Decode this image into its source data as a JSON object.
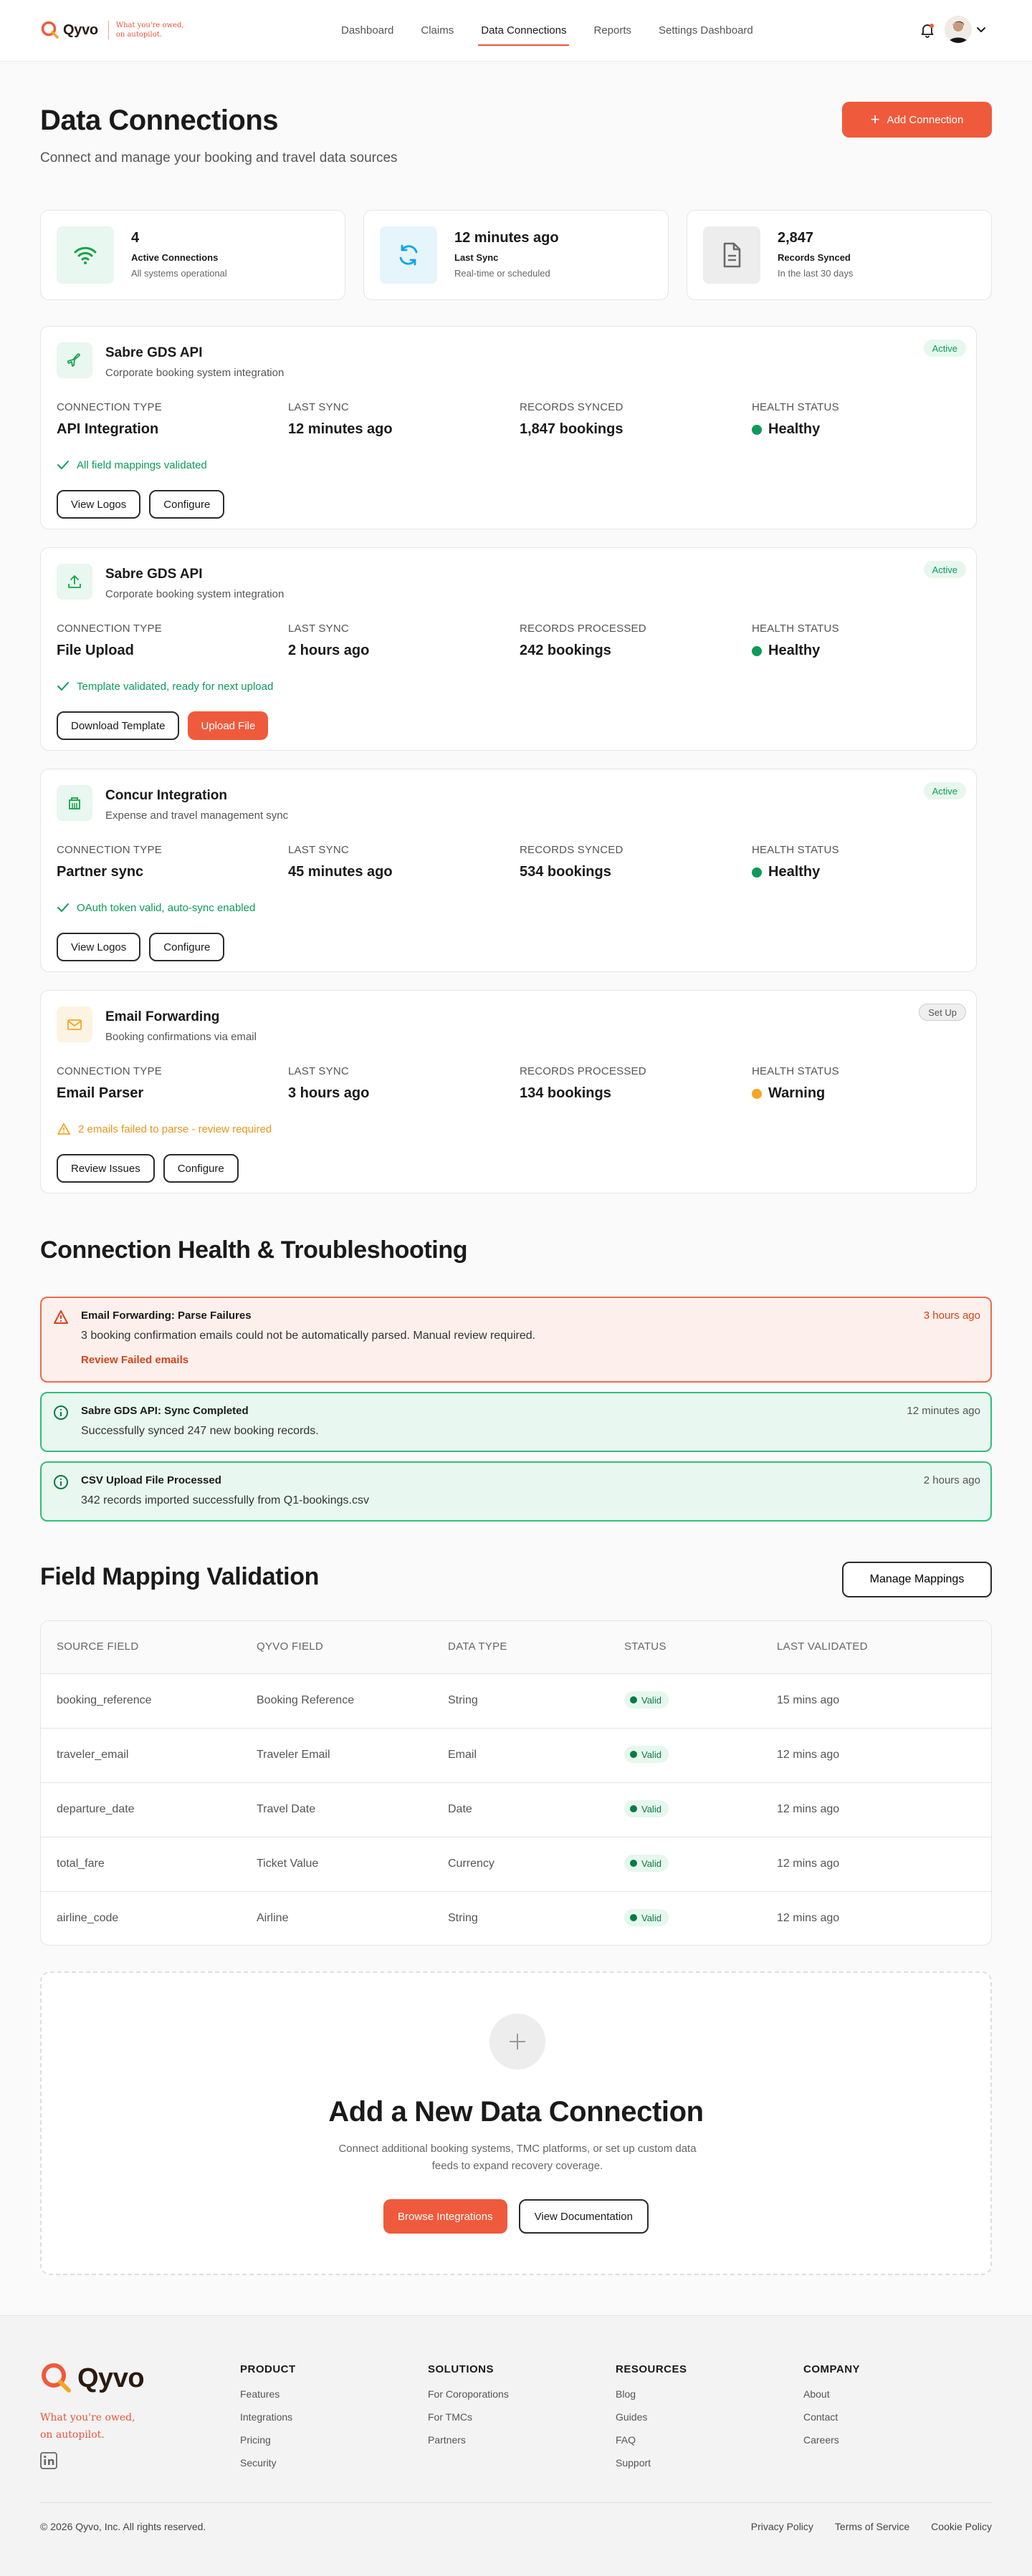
{
  "brand": {
    "name": "Qyvo",
    "tagline": "What you're owed, on autopilot."
  },
  "nav": [
    "Dashboard",
    "Claims",
    "Data Connections",
    "Reports",
    "Settings Dashboard"
  ],
  "nav_active": "Data Connections",
  "page": {
    "title": "Data Connections",
    "subtitle": "Connect and manage your booking and travel data sources",
    "add_button": "Add Connection"
  },
  "stats": [
    {
      "value": "4",
      "label": "Active Connections",
      "desc": "All systems operational",
      "icon": "wifi-icon",
      "color": "#16a34a"
    },
    {
      "value": "12 minutes ago",
      "label": "Last Sync",
      "desc": "Real-time or scheduled",
      "icon": "refresh-icon",
      "color": "#0ea5e9"
    },
    {
      "value": "2,847",
      "label": "Records Synced",
      "desc": "In the last 30 days",
      "icon": "document-icon",
      "color": "#6b6b6b"
    }
  ],
  "connections": [
    {
      "title": "Sabre GDS API",
      "subtitle": "Corporate booking system integration",
      "status": "Active",
      "icon": "plane-icon",
      "columns": [
        {
          "label": "CONNECTION TYPE",
          "value": "API Integration"
        },
        {
          "label": "LAST SYNC",
          "value": "12 minutes ago"
        },
        {
          "label": "RECORDS SYNCED",
          "value": "1,847 bookings"
        },
        {
          "label": "HEALTH STATUS",
          "value": "Healthy"
        }
      ],
      "note": "All field mappings validated",
      "buttons": [
        "View Logos",
        "Configure"
      ]
    },
    {
      "title": "Sabre GDS API",
      "subtitle": "Corporate booking system integration",
      "status": "Active",
      "icon": "upload-icon",
      "columns": [
        {
          "label": "CONNECTION TYPE",
          "value": "File Upload"
        },
        {
          "label": "LAST SYNC",
          "value": "2 hours ago"
        },
        {
          "label": "RECORDS PROCESSED",
          "value": "242 bookings"
        },
        {
          "label": "HEALTH STATUS",
          "value": "Healthy"
        }
      ],
      "note": "Template validated, ready for next upload",
      "buttons": [
        "Download Template",
        "Upload File"
      ]
    },
    {
      "title": "Concur Integration",
      "subtitle": "Expense and travel management sync",
      "status": "Active",
      "icon": "building-icon",
      "columns": [
        {
          "label": "CONNECTION TYPE",
          "value": "Partner sync"
        },
        {
          "label": "LAST SYNC",
          "value": "45 minutes ago"
        },
        {
          "label": "RECORDS SYNCED",
          "value": "534 bookings"
        },
        {
          "label": "HEALTH STATUS",
          "value": "Healthy"
        }
      ],
      "note": "OAuth token valid, auto-sync enabled",
      "buttons": [
        "View Logos",
        "Configure"
      ]
    },
    {
      "title": "Email Forwarding",
      "subtitle": "Booking confirmations via email",
      "status": "Set Up",
      "icon": "mail-icon",
      "columns": [
        {
          "label": "CONNECTION TYPE",
          "value": "Email Parser"
        },
        {
          "label": "LAST SYNC",
          "value": "3 hours ago"
        },
        {
          "label": "RECORDS PROCESSED",
          "value": "134 bookings"
        },
        {
          "label": "HEALTH STATUS",
          "value": "Warning"
        }
      ],
      "note": "2 emails failed to parse - review required",
      "buttons": [
        "Review Issues",
        "Configure"
      ]
    }
  ],
  "health": {
    "title": "Connection Health & Troubleshooting",
    "alerts": [
      {
        "title": "Email Forwarding: Parse Failures",
        "text": "3 booking confirmation emails could not be automatically parsed. Manual review required.",
        "time": "3 hours ago",
        "link": "Review Failed emails"
      },
      {
        "title": "Sabre GDS API: Sync Completed",
        "text": "Successfully synced 247 new booking records.",
        "time": "12 minutes ago"
      },
      {
        "title": "CSV Upload File Processed",
        "text": "342 records imported successfully from Q1-bookings.csv",
        "time": "2 hours ago"
      }
    ]
  },
  "mapping": {
    "title": "Field Mapping Validation",
    "manage_button": "Manage Mappings",
    "headers": [
      "SOURCE FIELD",
      "QYVO FIELD",
      "DATA TYPE",
      "STATUS",
      "LAST VALIDATED"
    ],
    "rows": [
      [
        "booking_reference",
        "Booking Reference",
        "String",
        "Valid",
        "15 mins ago"
      ],
      [
        "traveler_email",
        "Traveler Email",
        "Email",
        "Valid",
        "12 mins ago"
      ],
      [
        "departure_date",
        "Travel Date",
        "Date",
        "Valid",
        "12 mins ago"
      ],
      [
        "total_fare",
        "Ticket Value",
        "Currency",
        "Valid",
        "12 mins ago"
      ],
      [
        "airline_code",
        "Airline",
        "String",
        "Valid",
        "12 mins ago"
      ]
    ]
  },
  "add_new": {
    "title": "Add a New Data Connection",
    "text": "Connect additional booking systems, TMC platforms, or set up custom data feeds to expand recovery coverage.",
    "primary": "Browse Integrations",
    "secondary": "View Documentation"
  },
  "footer": {
    "tagline": "What you're owed, on autopilot.",
    "columns": [
      {
        "title": "PRODUCT",
        "items": [
          "Features",
          "Integrations",
          "Pricing",
          "Security"
        ]
      },
      {
        "title": "SOLUTIONS",
        "items": [
          "For Coroporations",
          "For TMCs",
          "Partners"
        ]
      },
      {
        "title": "RESOURCES",
        "items": [
          "Blog",
          "Guides",
          "FAQ",
          "Support"
        ]
      },
      {
        "title": "COMPANY",
        "items": [
          "About",
          "Contact",
          "Careers"
        ]
      }
    ],
    "copyright": "© 2026 Qyvo, Inc. All rights reserved.",
    "links": [
      "Privacy Policy",
      "Terms of Service",
      "Cookie Policy"
    ]
  },
  "colors": {
    "accent": "#ef5a3c",
    "success": "#0d9b5a",
    "warning": "#f5a623",
    "danger": "#d4431e"
  }
}
